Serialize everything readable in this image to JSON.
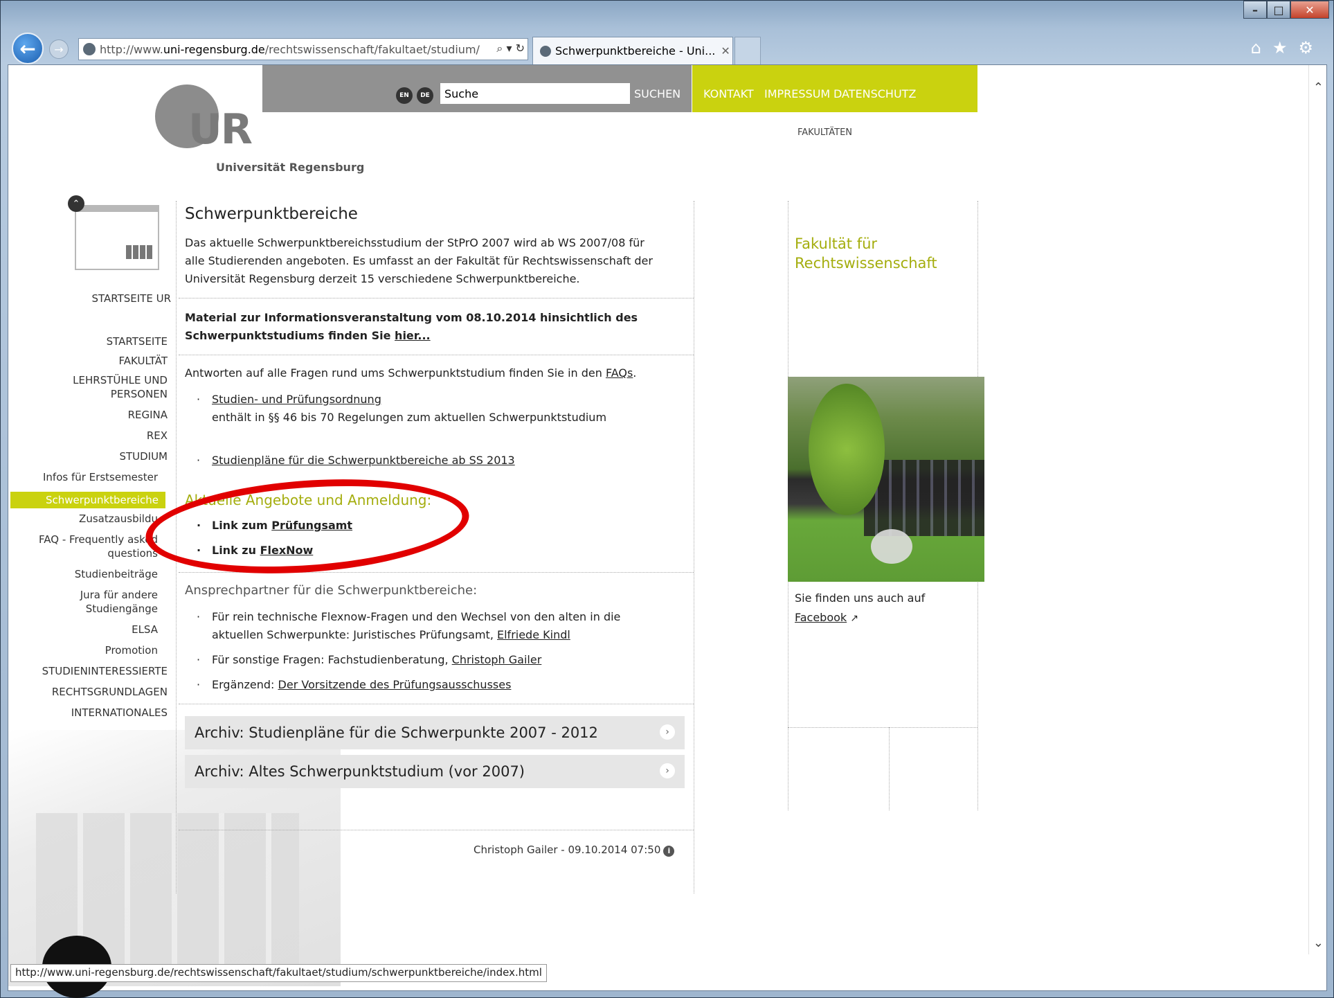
{
  "browser": {
    "url_prefix": "http://www.",
    "url_host": "uni-regensburg.de",
    "url_path": "/rechtswissenschaft/fakultaet/studium/",
    "address_tools": "⌕ ▾ ↻",
    "tab_title": "Schwerpunktbereiche - Uni...",
    "tab_close": "✕",
    "win_min": "–",
    "win_max": "□",
    "win_close": "✕",
    "right_icons": [
      "⌂",
      "★",
      "⚙"
    ],
    "status_url": "http://www.uni-regensburg.de/rechtswissenschaft/fakultaet/studium/schwerpunktbereiche/index.html"
  },
  "header": {
    "logo_text": "UR",
    "uni_name": "Universität Regensburg",
    "lang_en": "EN",
    "lang_de": "DE",
    "search_value": "Suche",
    "search_button": "SUCHEN",
    "nav": [
      "KONTAKT",
      "IMPRESSUM",
      "DATENSCHUTZ"
    ],
    "faculties": "FAKULTÄTEN"
  },
  "leftnav": {
    "startseite_ur": "STARTSEITE UR",
    "main": [
      "STARTSEITE",
      "FAKULTÄT",
      "LEHRSTÜHLE UND",
      "PERSONEN",
      "REGINA",
      "REX",
      "STUDIUM"
    ],
    "sub": [
      "Infos für Erstsemester",
      "Schwerpunktbereiche",
      "Zusatzausbildu",
      "FAQ - Frequently asked",
      "questions",
      "Studienbeiträge",
      "Jura für andere",
      "Studiengänge",
      "ELSA",
      "Promotion"
    ],
    "main2": [
      "STUDIENINTERESSIERTE",
      "RECHTSGRUNDLAGEN",
      "INTERNATIONALES"
    ]
  },
  "content": {
    "title": "Schwerpunktbereiche",
    "intro_1": "Das aktuelle Schwerpunktbereichsstudium der StPrO 2007 wird ab WS 2007/08 für",
    "intro_2": "alle Studierenden angeboten. Es umfasst an der Fakultät für Rechtswissenschaft der",
    "intro_3": "Universität Regensburg derzeit 15 verschiedene Schwerpunktbereiche.",
    "material_1": "Material zur Informationsveranstaltung vom 08.10.2014 hinsichtlich des",
    "material_2": "Schwerpunktstudiums finden Sie ",
    "material_link": "hier...",
    "faq_text": "Antworten auf alle Fragen rund ums Schwerpunktstudium finden Sie in den ",
    "faq_link": "FAQs",
    "faq_end": ".",
    "bullet_dot": "·",
    "b1_link": "Studien- und Prüfungsordnung",
    "b1_text": "enthält in §§ 46 bis 70 Regelungen zum aktuellen Schwerpunktstudium",
    "b2_link": "Studienpläne für die Schwerpunktbereiche ab SS 2013",
    "section_title": "Aktuelle Angebote und Anmeldung:",
    "link1_prefix": "Link zum ",
    "link1": "Prüfungsamt",
    "link2_prefix": "Link zu ",
    "link2": "FlexNow",
    "contact_title": "Ansprechpartner für die Schwerpunktbereiche:",
    "c1_a": "Für rein technische Flexnow-Fragen und den Wechsel von den alten in die",
    "c1_b": "aktuellen Schwerpunkte: Juristisches Prüfungsamt, ",
    "c1_link": "Elfriede Kindl",
    "c2": "Für sonstige Fragen: Fachstudienberatung, ",
    "c2_link": "Christoph Gailer",
    "c3": "Ergänzend: ",
    "c3_link": "Der Vorsitzende des Prüfungsausschusses",
    "accordion_1": "Archiv: Studienpläne für die Schwerpunkte 2007 - 2012",
    "accordion_2": "Archiv: Altes Schwerpunktstudium (vor 2007)",
    "accordion_arrow": "›",
    "footer": "Christoph Gailer - 09.10.2014 07:50",
    "info_icon": "i"
  },
  "right": {
    "title_1": "Fakultät für",
    "title_2": "Rechtswissenschaft",
    "text": "Sie finden uns auch auf",
    "fb_link": "Facebook",
    "fb_arrow": "↗"
  },
  "colors": {
    "brand_green": "#cad20f",
    "accent_green_text": "#a4ad0d",
    "annotation_red": "#e10000"
  }
}
